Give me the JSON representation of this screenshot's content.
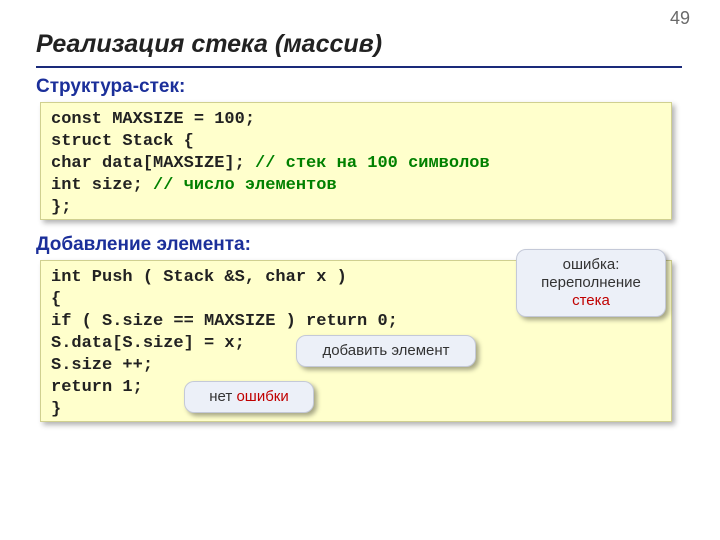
{
  "page_number": "49",
  "title": "Реализация стека (массив)",
  "sections": {
    "struct": "Структура-стек:",
    "add": "Добавление элемента:"
  },
  "code1": {
    "l1": "const MAXSIZE = 100;",
    "l2": "struct Stack {",
    "l3a": "   char data[MAXSIZE]; ",
    "l3b": "// стек на 100 символов",
    "l4a": "   int  size;       ",
    "l4b": "// число элементов",
    "l5": "   };"
  },
  "code2": {
    "l1": "int Push ( Stack &S, char x )",
    "l2": "{",
    "l3": "if ( S.size == MAXSIZE ) return 0;",
    "l4": "S.data[S.size] = x;",
    "l5": "S.size ++;",
    "l6": "return 1;",
    "l7": "}"
  },
  "callouts": {
    "overflow_a": "ошибка: переполнение",
    "overflow_b": "стека",
    "add": "добавить элемент",
    "noerr_a": "нет ",
    "noerr_b": "ошибки"
  }
}
